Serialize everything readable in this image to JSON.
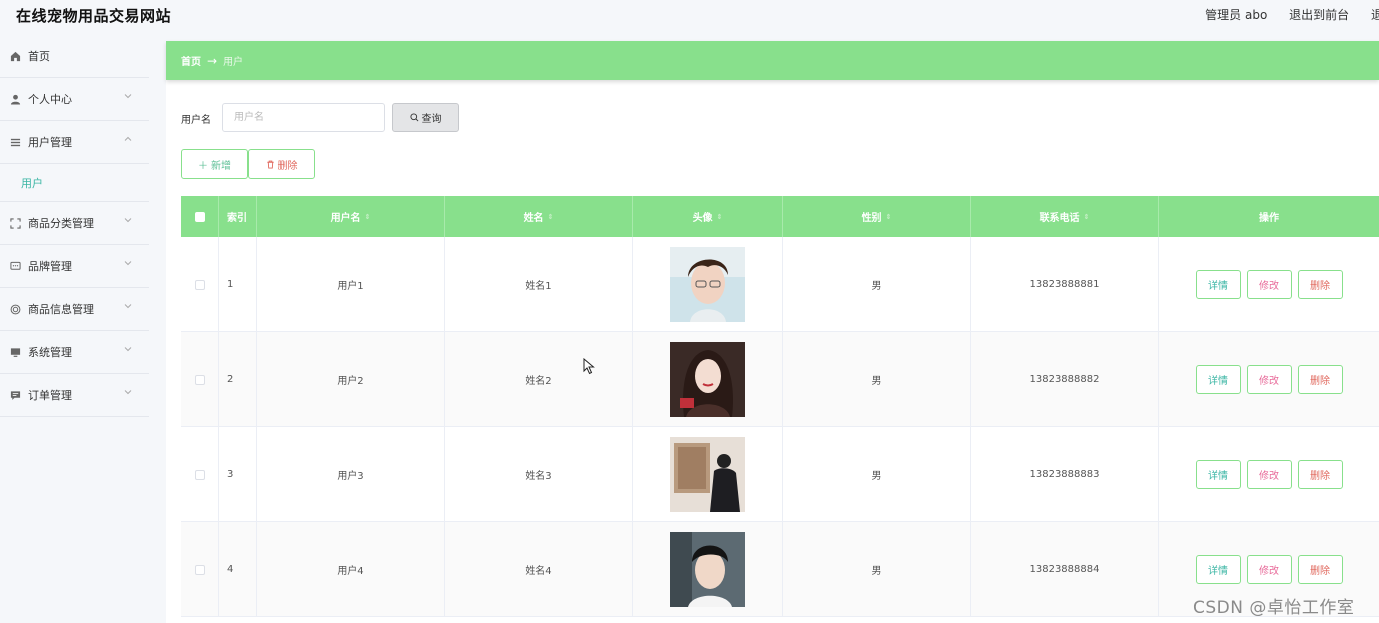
{
  "app": {
    "title": "在线宠物用品交易网站"
  },
  "topbar": {
    "admin_label": "管理员 abo",
    "exit_front": "退出到前台",
    "exit_login": "退出登录"
  },
  "sidebar": {
    "items": [
      {
        "label": "首页",
        "icon": "home-icon"
      },
      {
        "label": "个人中心",
        "icon": "user-icon"
      },
      {
        "label": "用户管理",
        "icon": "menu-icon",
        "expanded": true
      },
      {
        "label": "用户",
        "sub": true
      },
      {
        "label": "商品分类管理",
        "icon": "frame-icon"
      },
      {
        "label": "品牌管理",
        "icon": "chat-icon"
      },
      {
        "label": "商品信息管理",
        "icon": "circle-icon"
      },
      {
        "label": "系统管理",
        "icon": "monitor-icon"
      },
      {
        "label": "订单管理",
        "icon": "message-icon"
      }
    ]
  },
  "breadcrumb": {
    "home": "首页",
    "separator": "→",
    "current": "用户"
  },
  "search": {
    "label": "用户名",
    "placeholder": "用户名",
    "value": "",
    "button": "查询"
  },
  "actions": {
    "add": "新增",
    "delete": "删除"
  },
  "table": {
    "headers": [
      "索引",
      "用户名",
      "姓名",
      "头像",
      "性别",
      "联系电话",
      "操作"
    ],
    "rows": [
      {
        "index": "1",
        "username": "用户1",
        "name": "姓名1",
        "gender": "男",
        "phone": "13823888881"
      },
      {
        "index": "2",
        "username": "用户2",
        "name": "姓名2",
        "gender": "男",
        "phone": "13823888882"
      },
      {
        "index": "3",
        "username": "用户3",
        "name": "姓名3",
        "gender": "男",
        "phone": "13823888883"
      },
      {
        "index": "4",
        "username": "用户4",
        "name": "姓名4",
        "gender": "男",
        "phone": "13823888884"
      }
    ],
    "op_labels": {
      "detail": "详情",
      "edit": "修改",
      "delete": "删除"
    }
  },
  "watermark": "CSDN @卓怡工作室",
  "colors": {
    "accent": "#88e08c",
    "teal": "#3bb6a4",
    "pink": "#e86b9a",
    "red": "#e0675c"
  }
}
